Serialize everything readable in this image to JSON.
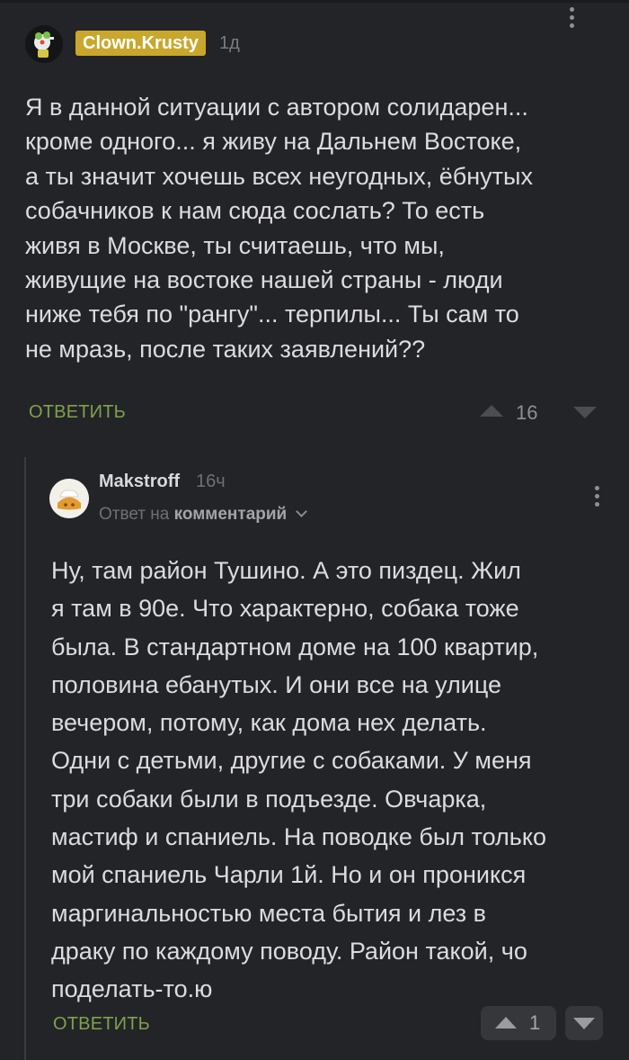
{
  "parent_comment": {
    "author": "Clown.Krusty",
    "time": "1д",
    "body_lines": [
      "Я в данной ситуации с автором солидарен...",
      "кроме одного... я живу на Дальнем Востоке,",
      "а ты значит хочешь всех неугодных, ёбнутых",
      "собачников к нам сюда сослать? То есть",
      "живя в Москве, ты считаешь, что мы,",
      "живущие на востоке нашей страны - люди",
      "ниже тебя по \"рангу\"... терпилы... Ты сам то",
      "не мразь, после таких заявлений??"
    ],
    "reply_label": "ОТВЕТИТЬ",
    "rating": "16",
    "badge_color": "#c9a72c"
  },
  "reply_comment": {
    "author": "Makstroff",
    "time": "16ч",
    "reply_to_prefix": "Ответ на",
    "reply_to_link": "комментарий",
    "body_lines": [
      "Ну, там район Тушино. А это пиздец. Жил",
      "я там в 90е. Что характерно, собака тоже",
      "была. В стандартном доме на 100 квартир,",
      "половина ебанутых. И они все на улице",
      "вечером, потому, как дома нех делать.",
      "Одни с детьми, другие с собаками. У меня",
      "три собаки были в подъезде. Овчарка,",
      "мастиф и спаниель. На поводке был только",
      "мой спаниель Чарли 1й. Но и он проникся",
      "маргинальностью места бытия и лез в",
      "драку по каждому поводу. Район такой, чо",
      "поделать-то.ю"
    ],
    "reply_label": "ОТВЕТИТЬ",
    "rating": "1"
  },
  "icons": {
    "menu": "vertical-dots-icon",
    "upvote": "triangle-up-icon",
    "downvote": "triangle-down-icon",
    "expand": "chevron-down-icon"
  },
  "colors": {
    "background": "#232427",
    "text": "#dcdcde",
    "muted": "#6f7074",
    "reply_green": "#7ea24d"
  }
}
